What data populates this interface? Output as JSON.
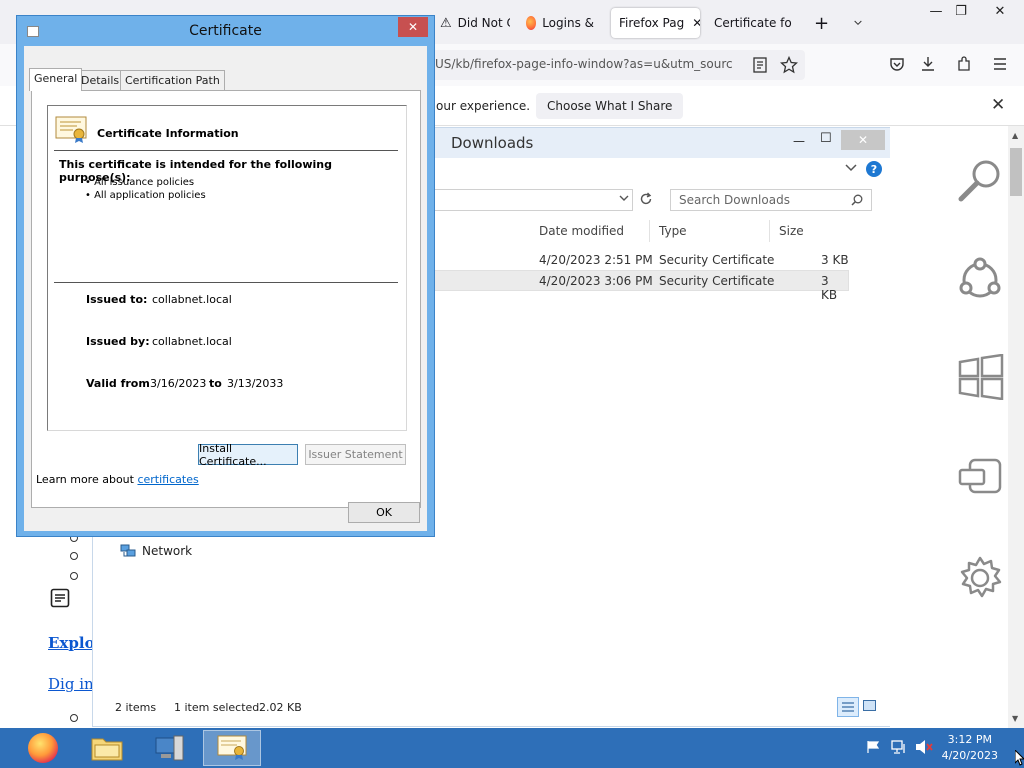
{
  "firefox": {
    "tabs": [
      {
        "label": "Did Not C"
      },
      {
        "label": "Logins &"
      },
      {
        "label": "Firefox Pag"
      },
      {
        "label": "Certificate for"
      }
    ],
    "url": "US/kb/firefox-page-info-window?as=u&utm_sourc",
    "notification": {
      "text": "our experience.",
      "button": "Choose What I Share"
    },
    "page_links": [
      "Explor",
      "Dig int"
    ]
  },
  "explorer": {
    "title": "Downloads",
    "search_placeholder": "Search Downloads",
    "columns": {
      "date": "Date modified",
      "type": "Type",
      "size": "Size"
    },
    "rows": [
      {
        "date": "4/20/2023 2:51 PM",
        "type": "Security Certificate",
        "size": "3 KB"
      },
      {
        "date": "4/20/2023 3:06 PM",
        "type": "Security Certificate",
        "size": "3 KB"
      }
    ],
    "nav_network": "Network",
    "status": {
      "items": "2 items",
      "selected": "1 item selected",
      "size": "2.02 KB"
    }
  },
  "cert": {
    "title": "Certificate",
    "tabs": [
      "General",
      "Details",
      "Certification Path"
    ],
    "info_heading": "Certificate Information",
    "purpose_heading": "This certificate is intended for the following purpose(s):",
    "purposes": [
      "All issuance policies",
      "All application policies"
    ],
    "issued_to_label": "Issued to:",
    "issued_to": "collabnet.local",
    "issued_by_label": "Issued by:",
    "issued_by": "collabnet.local",
    "valid_from_label": "Valid from",
    "valid_from": "3/16/2023",
    "to_label": "to",
    "valid_to": "3/13/2033",
    "install_button": "Install Certificate...",
    "issuer_button": "Issuer Statement",
    "learn_more_prefix": "Learn more about",
    "learn_more_link": "certificates",
    "ok_button": "OK"
  },
  "taskbar": {
    "time": "3:12 PM",
    "date": "4/20/2023"
  }
}
